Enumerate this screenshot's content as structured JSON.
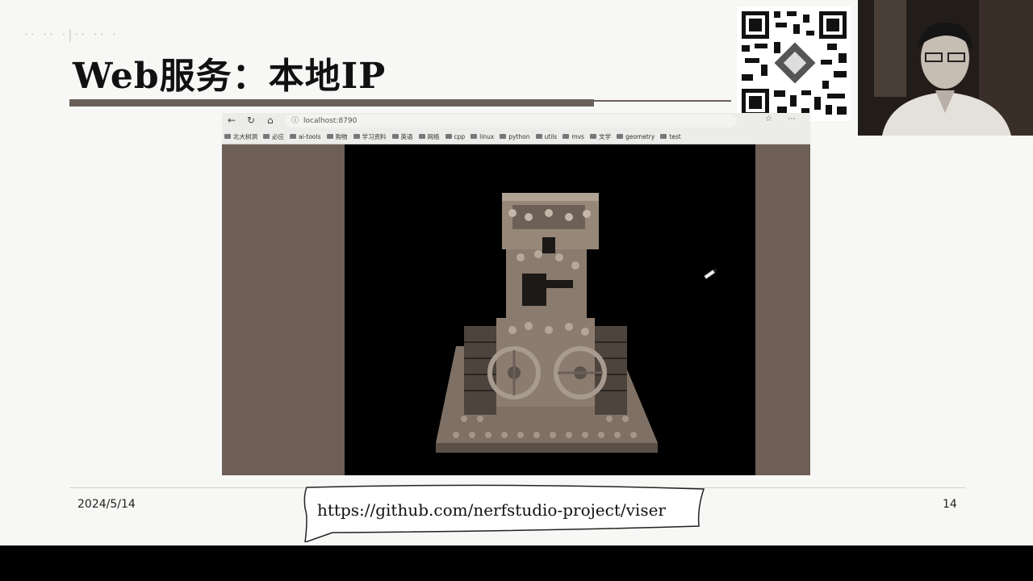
{
  "slide": {
    "title": "Web服务：本地IP",
    "faded_header": "·· ·· ·|·· ·· ·",
    "date": "2024/5/14",
    "page_number": "14",
    "link": "https://github.com/nerfstudio-project/viser"
  },
  "browser": {
    "url": "localhost:8790",
    "nav": {
      "back": "←",
      "reload": "↻",
      "home": "⌂"
    },
    "bookmarks": [
      {
        "label": "北大树洞",
        "icon": "folder-icon"
      },
      {
        "label": "必应",
        "icon": "folder-icon"
      },
      {
        "label": "ai-tools",
        "icon": "folder-icon"
      },
      {
        "label": "购物",
        "icon": "folder-icon"
      },
      {
        "label": "学习资料",
        "icon": "folder-icon"
      },
      {
        "label": "英语",
        "icon": "folder-icon"
      },
      {
        "label": "网络",
        "icon": "folder-icon"
      },
      {
        "label": "cpp",
        "icon": "folder-icon"
      },
      {
        "label": "linux",
        "icon": "folder-icon"
      },
      {
        "label": "python",
        "icon": "folder-icon"
      },
      {
        "label": "utils",
        "icon": "folder-icon"
      },
      {
        "label": "mvs",
        "icon": "folder-icon"
      },
      {
        "label": "文学",
        "icon": "folder-icon"
      },
      {
        "label": "geometry",
        "icon": "folder-icon"
      },
      {
        "label": "test",
        "icon": "folder-icon"
      }
    ]
  },
  "colors": {
    "title_bar": "#6b6058",
    "viewport_side": "#6d5f55",
    "model": "#8c7c70"
  }
}
